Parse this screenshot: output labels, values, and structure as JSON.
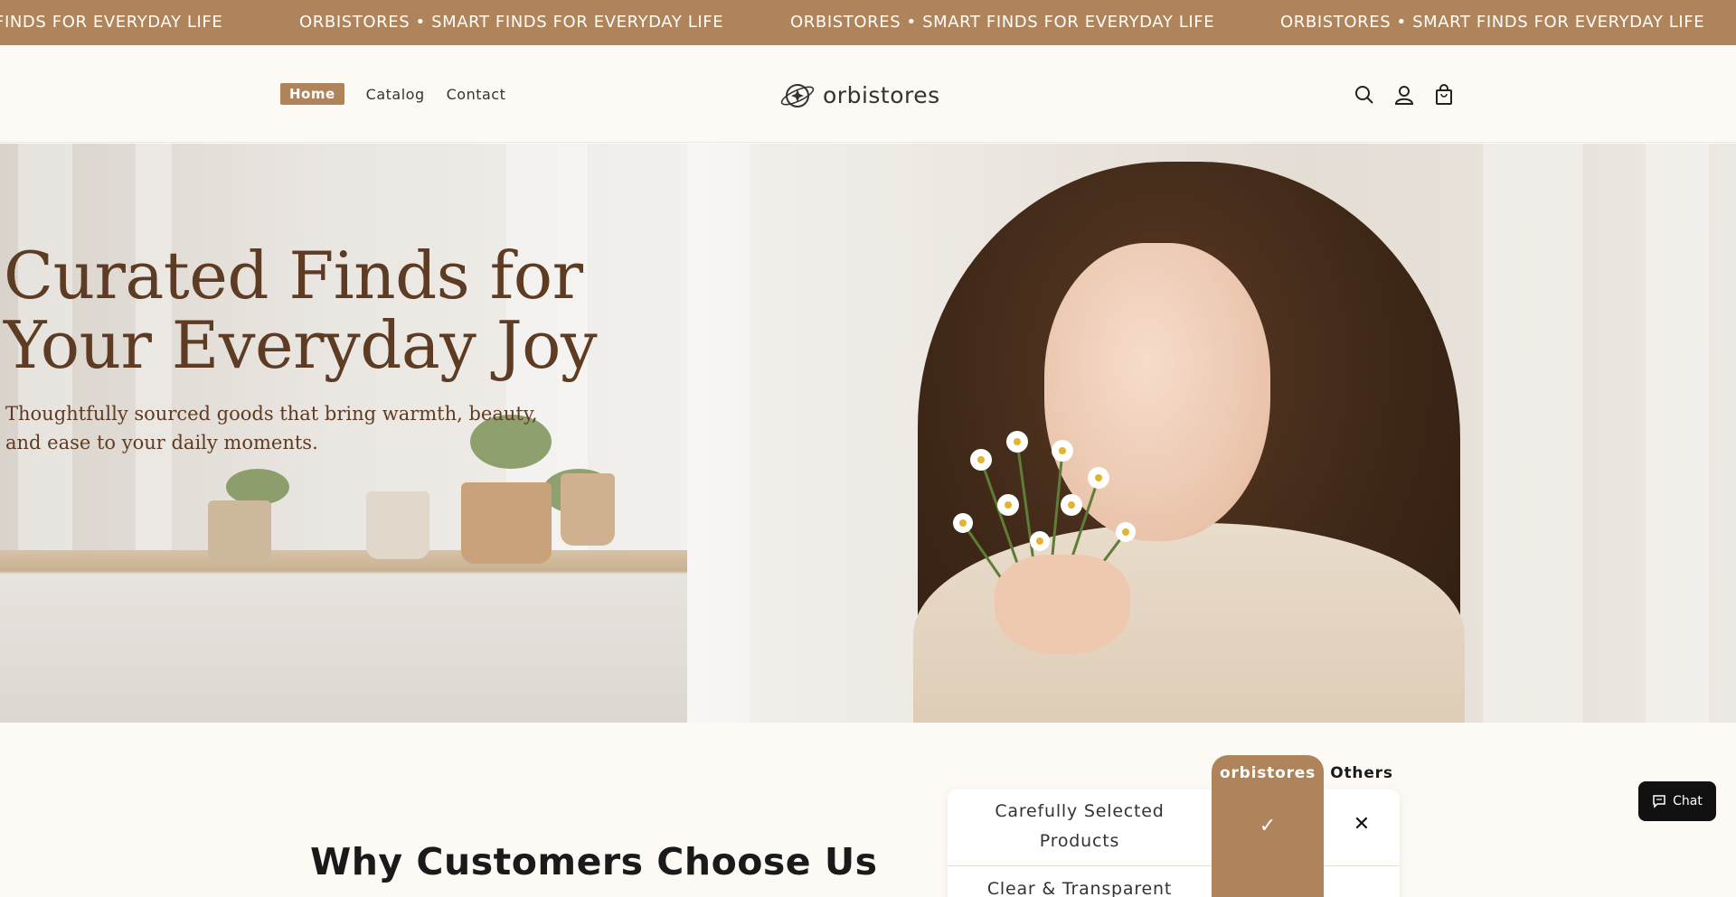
{
  "announcement": {
    "items": [
      "FINDS FOR EVERYDAY LIFE",
      "ORBISTORES • SMART FINDS FOR EVERYDAY LIFE",
      "ORBISTORES • SMART FINDS FOR EVERYDAY LIFE",
      "ORBISTORES • SMART FINDS FOR EVERYDAY LIFE"
    ]
  },
  "header": {
    "nav": {
      "home": "Home",
      "catalog": "Catalog",
      "contact": "Contact"
    },
    "logo_text": "orbistores",
    "icons": [
      "search-icon",
      "account-icon",
      "cart-icon"
    ]
  },
  "hero": {
    "title_line1": "Curated Finds for",
    "title_line2": "Your Everyday Joy",
    "subtitle_line1": "Thoughtfully sourced goods that bring warmth, beauty,",
    "subtitle_line2": "and ease to your daily moments."
  },
  "why": {
    "title": "Why Customers Choose Us",
    "compare": {
      "brand_header": "orbistores",
      "others_header": "Others",
      "row1_line1": "Carefully Selected",
      "row1_line2": "Products",
      "row2": "Clear & Transparent",
      "brand_mark": "✓",
      "others_mark": "✕"
    }
  },
  "chat": {
    "label": "Chat"
  },
  "colors": {
    "accent": "#b0845a",
    "hero_text": "#5e3b23",
    "background": "#fdfaf5"
  }
}
